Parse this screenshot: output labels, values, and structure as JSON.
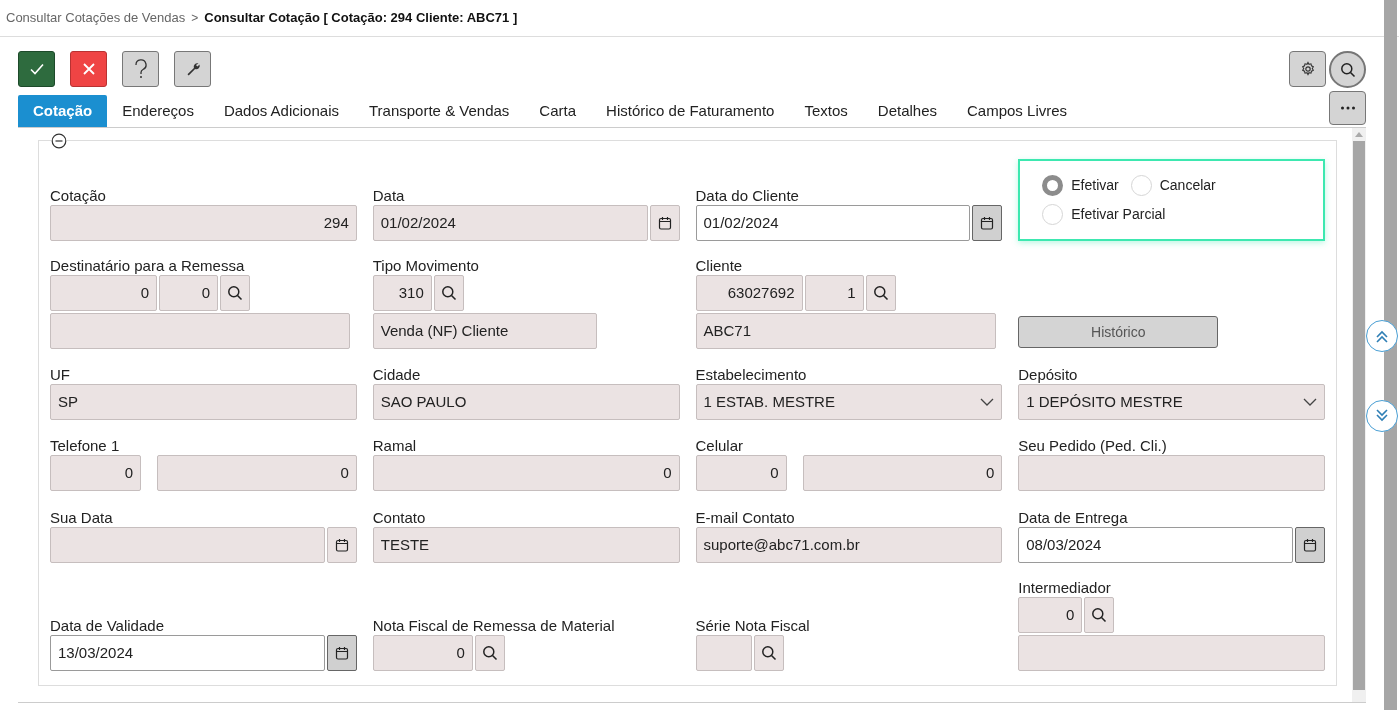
{
  "breadcrumb": {
    "parent": "Consultar Cotações de Vendas",
    "separator": ">",
    "current": "Consultar Cotação [ Cotação: 294 Cliente: ABC71 ]"
  },
  "toolbar": [
    {
      "kind": "confirm"
    },
    {
      "kind": "cancel"
    },
    {
      "kind": "help"
    },
    {
      "kind": "tools"
    }
  ],
  "toolbar_right": [
    {
      "kind": "settings"
    },
    {
      "kind": "search"
    }
  ],
  "tabs": [
    {
      "label": "Cotação",
      "selected": true
    },
    {
      "label": "Endereços",
      "selected": false
    },
    {
      "label": "Dados Adicionais",
      "selected": false
    },
    {
      "label": "Transporte & Vendas",
      "selected": false
    },
    {
      "label": "Carta",
      "selected": false
    },
    {
      "label": "Histórico de Faturamento",
      "selected": false
    },
    {
      "label": "Textos",
      "selected": false
    },
    {
      "label": "Detalhes",
      "selected": false
    },
    {
      "label": "Campos Livres",
      "selected": false
    }
  ],
  "form": {
    "rows": [
      [
        {
          "kind": "text",
          "label": "Cotação",
          "value": "294",
          "numeric": true,
          "editable": false
        },
        {
          "kind": "date",
          "label": "Data",
          "value": "01/02/2024",
          "editable": false
        },
        {
          "kind": "date",
          "label": "Data do Cliente",
          "value": "01/02/2024",
          "editable": true
        },
        {
          "kind": "radio_group",
          "options": [
            {
              "label": "Efetivar",
              "selected": true
            },
            {
              "label": "Cancelar",
              "selected": false
            },
            {
              "label": "Efetivar Parcial",
              "selected": false
            }
          ]
        }
      ],
      [
        {
          "kind": "lookup",
          "label": "Destinatário para a Remessa",
          "parts": [
            "0",
            "0"
          ],
          "with_description": true
        },
        {
          "kind": "lookup",
          "label": "Tipo Movimento",
          "parts": [
            "310"
          ],
          "description": "Venda (NF) Cliente"
        },
        {
          "kind": "lookup",
          "label": "Cliente",
          "parts": [
            "63027692",
            "1"
          ],
          "description": "ABC71"
        },
        {
          "kind": "button",
          "label": "Histórico"
        }
      ],
      [
        {
          "kind": "text",
          "label": "UF",
          "value": "SP",
          "numeric": false,
          "editable": false
        },
        {
          "kind": "text",
          "label": "Cidade",
          "value": "SAO PAULO",
          "numeric": false,
          "editable": false
        },
        {
          "kind": "select",
          "label": "Estabelecimento",
          "value": "1 ESTAB. MESTRE"
        },
        {
          "kind": "select",
          "label": "Depósito",
          "value": "1 DEPÓSITO MESTRE"
        }
      ],
      [
        {
          "kind": "pair",
          "label": "Telefone 1",
          "parts": [
            "0",
            "0"
          ]
        },
        {
          "kind": "text",
          "label": "Ramal",
          "value": "0",
          "numeric": true,
          "editable": false
        },
        {
          "kind": "pair",
          "label": "Celular",
          "parts": [
            "0",
            "0"
          ]
        },
        {
          "kind": "text",
          "label": "Seu Pedido (Ped. Cli.)",
          "editable": false
        }
      ],
      [
        {
          "kind": "date",
          "label": "Sua Data",
          "editable": false
        },
        {
          "kind": "text",
          "label": "Contato",
          "value": "TESTE",
          "numeric": false,
          "editable": false
        },
        {
          "kind": "text",
          "label": "E-mail Contato",
          "value": "suporte@abc71.com.br",
          "numeric": false,
          "editable": false
        },
        {
          "kind": "date",
          "label": "Data de Entrega",
          "value": "08/03/2024",
          "editable": true
        }
      ],
      [
        {
          "kind": "date",
          "label": "Data de Validade",
          "value": "13/03/2024",
          "editable": true
        },
        {
          "kind": "lookup",
          "label": "Nota Fiscal de Remessa de Material",
          "parts": [
            "0"
          ]
        },
        {
          "kind": "lookup",
          "label": "Série Nota Fiscal"
        },
        {
          "kind": "lookup",
          "label": "Intermediador",
          "parts": [
            "0"
          ],
          "with_description": true
        }
      ]
    ]
  }
}
